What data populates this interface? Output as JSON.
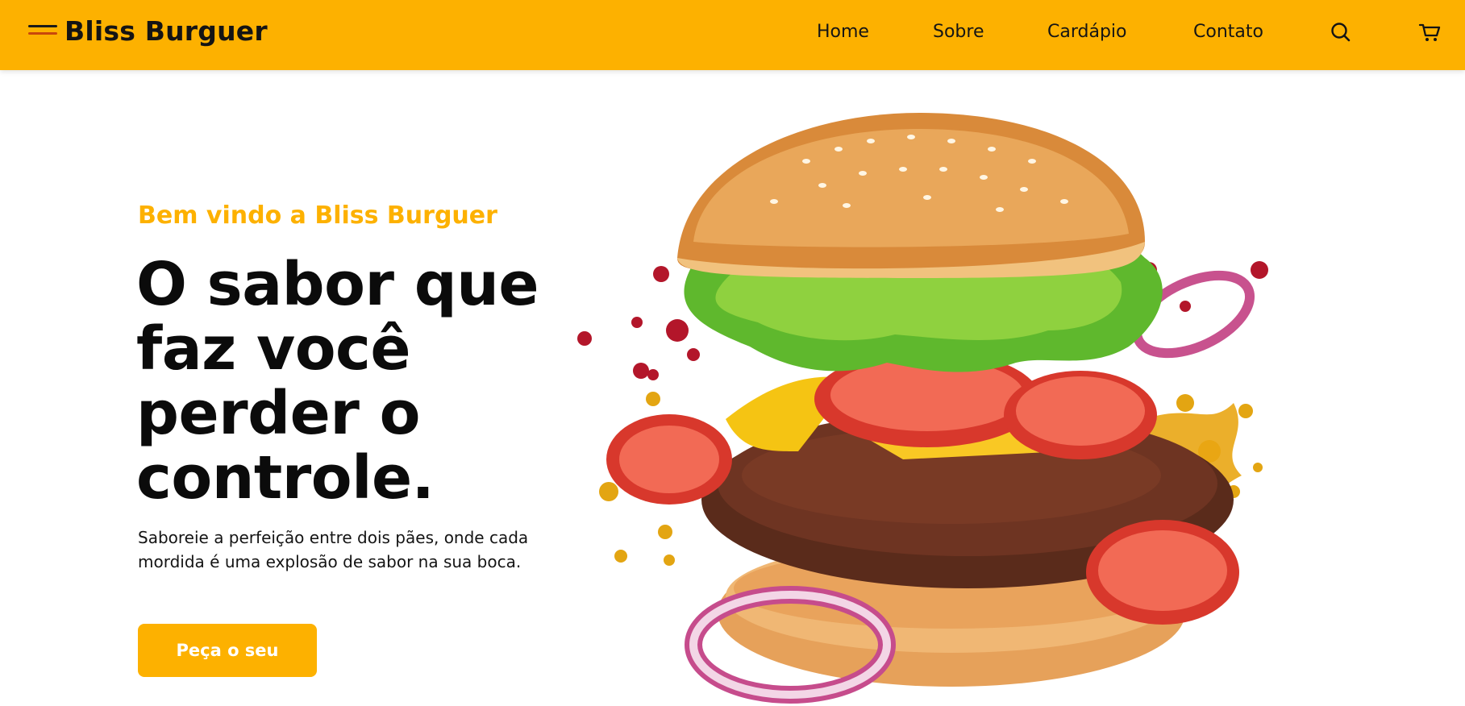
{
  "header": {
    "brand": "Bliss Burguer",
    "nav": [
      {
        "label": "Home"
      },
      {
        "label": "Sobre"
      },
      {
        "label": "Cardápio"
      },
      {
        "label": "Contato"
      }
    ],
    "icons": {
      "menu": "menu-icon",
      "search": "search-icon",
      "cart": "cart-icon"
    }
  },
  "hero": {
    "welcome": "Bem vindo a Bliss Burguer",
    "headline_lines": [
      "O sabor que",
      "faz você",
      "perder o",
      "controle."
    ],
    "subtext": "Saboreie a perfeição entre dois pães, onde cada mordida é uma explosão de sabor na sua boca.",
    "cta_label": "Peça o seu",
    "image": "burger-illustration"
  },
  "colors": {
    "accent": "#fdb100",
    "text": "#0b0b0b",
    "background": "#ffffff"
  }
}
